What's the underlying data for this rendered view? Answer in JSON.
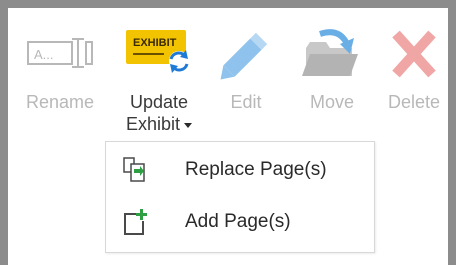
{
  "ribbon": {
    "buttons": [
      {
        "id": "rename",
        "label": "Rename",
        "icon": "rename-field-icon",
        "enabled": false
      },
      {
        "id": "update_exhibit",
        "label": "Update",
        "label2": "Exhibit",
        "icon": "update-exhibit-icon",
        "icon_text": "EXHIBIT",
        "enabled": true,
        "has_dropdown": true
      },
      {
        "id": "edit",
        "label": "Edit",
        "icon": "pencil-icon",
        "enabled": false
      },
      {
        "id": "move",
        "label": "Move",
        "icon": "move-to-folder-icon",
        "enabled": false
      },
      {
        "id": "delete",
        "label": "Delete",
        "icon": "delete-x-icon",
        "enabled": false
      }
    ]
  },
  "dropdown": {
    "items": [
      {
        "label": "Replace Page(s)",
        "icon": "replace-pages-icon"
      },
      {
        "label": "Add Page(s)",
        "icon": "add-page-icon"
      }
    ]
  },
  "colors": {
    "disabled_text": "#b8b8b8",
    "text": "#2a2a2a",
    "exhibit_yellow": "#f2c300",
    "sync_blue": "#1f7ad6",
    "edit_blue": "#8fc2ec",
    "move_blue": "#6aaee6",
    "folder_gray": "#c8c8c8",
    "delete_red": "#f1a6a6",
    "add_green": "#2ea043",
    "frame_gray": "#8c8c8c"
  }
}
